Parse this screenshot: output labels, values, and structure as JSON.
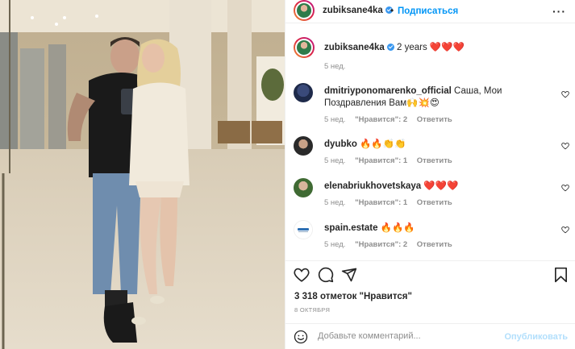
{
  "post": {
    "username": "zubiksane4ka",
    "dot": "•",
    "follow_label": "Подписаться",
    "more_icon": "more-horizontal-icon",
    "caption": {
      "username": "zubiksane4ka",
      "text": "2 years ❤️❤️❤️",
      "time": "5 нед."
    },
    "comments": [
      {
        "username": "dmitriyponomarenko_official",
        "text": "Саша, Мои Поздравления Вам🙌💥😍",
        "time": "5 нед.",
        "likes": "\"Нравится\": 2",
        "reply": "Ответить"
      },
      {
        "username": "dyubko",
        "text": "🔥🔥👏👏",
        "time": "5 нед.",
        "likes": "\"Нравится\": 1",
        "reply": "Ответить"
      },
      {
        "username": "elenabriukhovetskaya",
        "text": "❤️❤️❤️",
        "time": "5 нед.",
        "likes": "\"Нравится\": 1",
        "reply": "Ответить"
      },
      {
        "username": "spain.estate",
        "text": "🔥🔥🔥",
        "time": "5 нед.",
        "likes": "\"Нравится\": 2",
        "reply": "Ответить"
      }
    ],
    "likes_count": "3 318 отметок \"Нравится\"",
    "date": "8 ОКТЯБРЯ",
    "comment_placeholder": "Добавьте комментарий...",
    "publish_label": "Опубликовать"
  },
  "colors": {
    "accent": "#0095f6",
    "verified": "#3897f0",
    "muted": "#8e8e8e",
    "publish_disabled": "#b2dffc"
  }
}
